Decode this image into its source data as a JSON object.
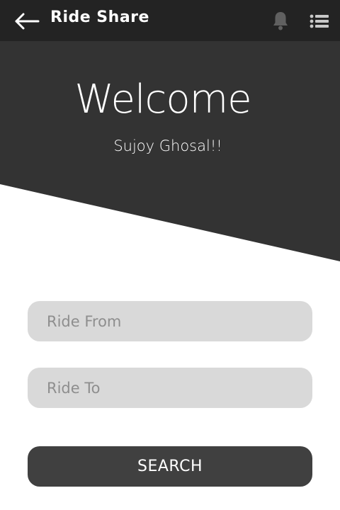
{
  "header": {
    "title": "Ride Share",
    "back_icon": "arrow-left-icon",
    "notification_icon": "bell-icon",
    "menu_icon": "list-menu-icon"
  },
  "hero": {
    "welcome": "Welcome",
    "username": "Sujoy Ghosal!!"
  },
  "form": {
    "from_placeholder": "Ride From",
    "to_placeholder": "Ride To",
    "from_value": "",
    "to_value": "",
    "search_label": "SEARCH"
  },
  "colors": {
    "topbar": "#232323",
    "hero": "#333333",
    "field": "#d9d9d9",
    "button": "#404040"
  }
}
